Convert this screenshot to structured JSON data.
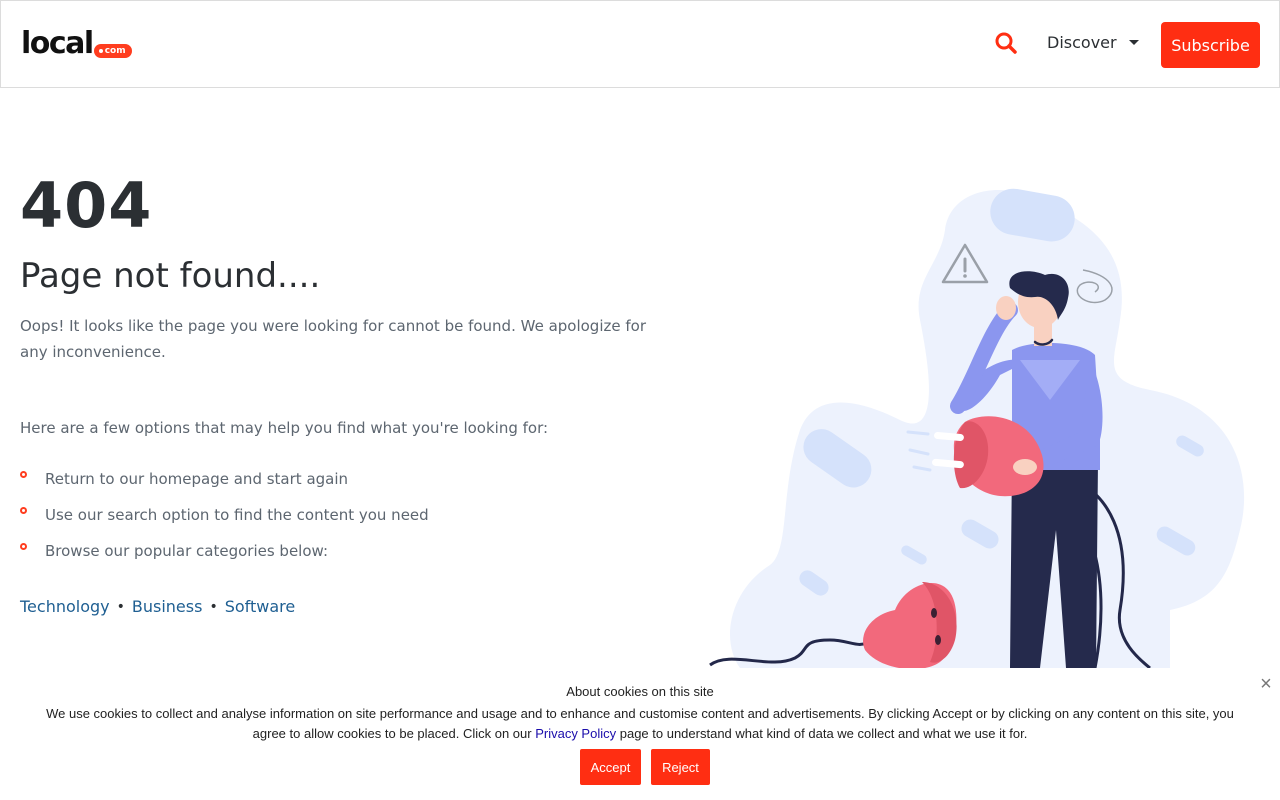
{
  "header": {
    "logo_word": "local",
    "logo_suffix": "com",
    "discover_label": "Discover",
    "subscribe_label": "Subscribe"
  },
  "main": {
    "code": "404",
    "title": "Page not found....",
    "apology": "Oops! It looks like the page you were looking for cannot be found. We apologize for any inconvenience.",
    "options_intro": "Here are a few options that may help you find what you're looking for:",
    "options": [
      "Return to our homepage and start again",
      "Use our search option to find the content you need",
      "Browse our popular categories below:"
    ],
    "categories": [
      "Technology",
      "Business",
      "Software"
    ]
  },
  "cookie": {
    "title": "About cookies on this site",
    "text_before": "We use cookies to collect and analyse information on site performance and usage and to enhance and customise content and advertisements. By clicking Accept or by clicking on any content on this site, you agree to allow cookies to be placed. Click on our ",
    "link_label": "Privacy Policy",
    "text_after": " page to understand what kind of data we collect and what we use it for.",
    "close_glyph": "×",
    "accept_label": "Accept",
    "reject_label": "Reject"
  },
  "colors": {
    "accent": "#ff2e12",
    "link": "#1f5f92",
    "text": "#2b2f33",
    "muted": "#5d6670"
  },
  "icons": [
    "search-icon",
    "caret-down-icon",
    "close-icon",
    "bullet-icon"
  ]
}
